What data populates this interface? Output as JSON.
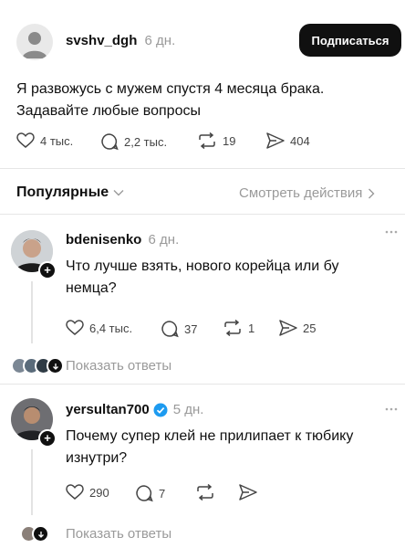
{
  "post": {
    "username": "svshv_dgh",
    "time": "6 дн.",
    "subscribe_label": "Подписаться",
    "text_line1": "Я развожусь с мужем спустя 4 месяца брака.",
    "text_line2": "Задавайте любые вопросы",
    "likes": "4 тыс.",
    "comments": "2,2 тыс.",
    "reposts": "19",
    "shares": "404"
  },
  "filter": {
    "sort_label": "Популярные",
    "activity_label": "Смотреть действия"
  },
  "replies": [
    {
      "username": "bdenisenko",
      "time": "6 дн.",
      "text_line1": "Что лучше взять, нового корейца или бу",
      "text_line2": "немца?",
      "likes": "6,4 тыс.",
      "comments": "37",
      "reposts": "1",
      "shares": "25",
      "show_replies": "Показать ответы",
      "verified": false
    },
    {
      "username": "yersultan700",
      "time": "5 дн.",
      "text_line1": "Почему супер клей не прилипает к тюбику",
      "text_line2": "изнутри?",
      "likes": "290",
      "comments": "7",
      "reposts": "",
      "shares": "",
      "show_replies": "Показать ответы",
      "verified": true
    }
  ],
  "colors": {
    "accent": "#101010",
    "muted": "#9a9a9a",
    "verified": "#1d9bf0"
  },
  "icons": [
    "user-icon",
    "heart-icon",
    "comment-icon",
    "repost-icon",
    "share-icon",
    "chevron-down-icon",
    "chevron-right-icon",
    "more-icon",
    "plus-icon",
    "verified-icon"
  ]
}
